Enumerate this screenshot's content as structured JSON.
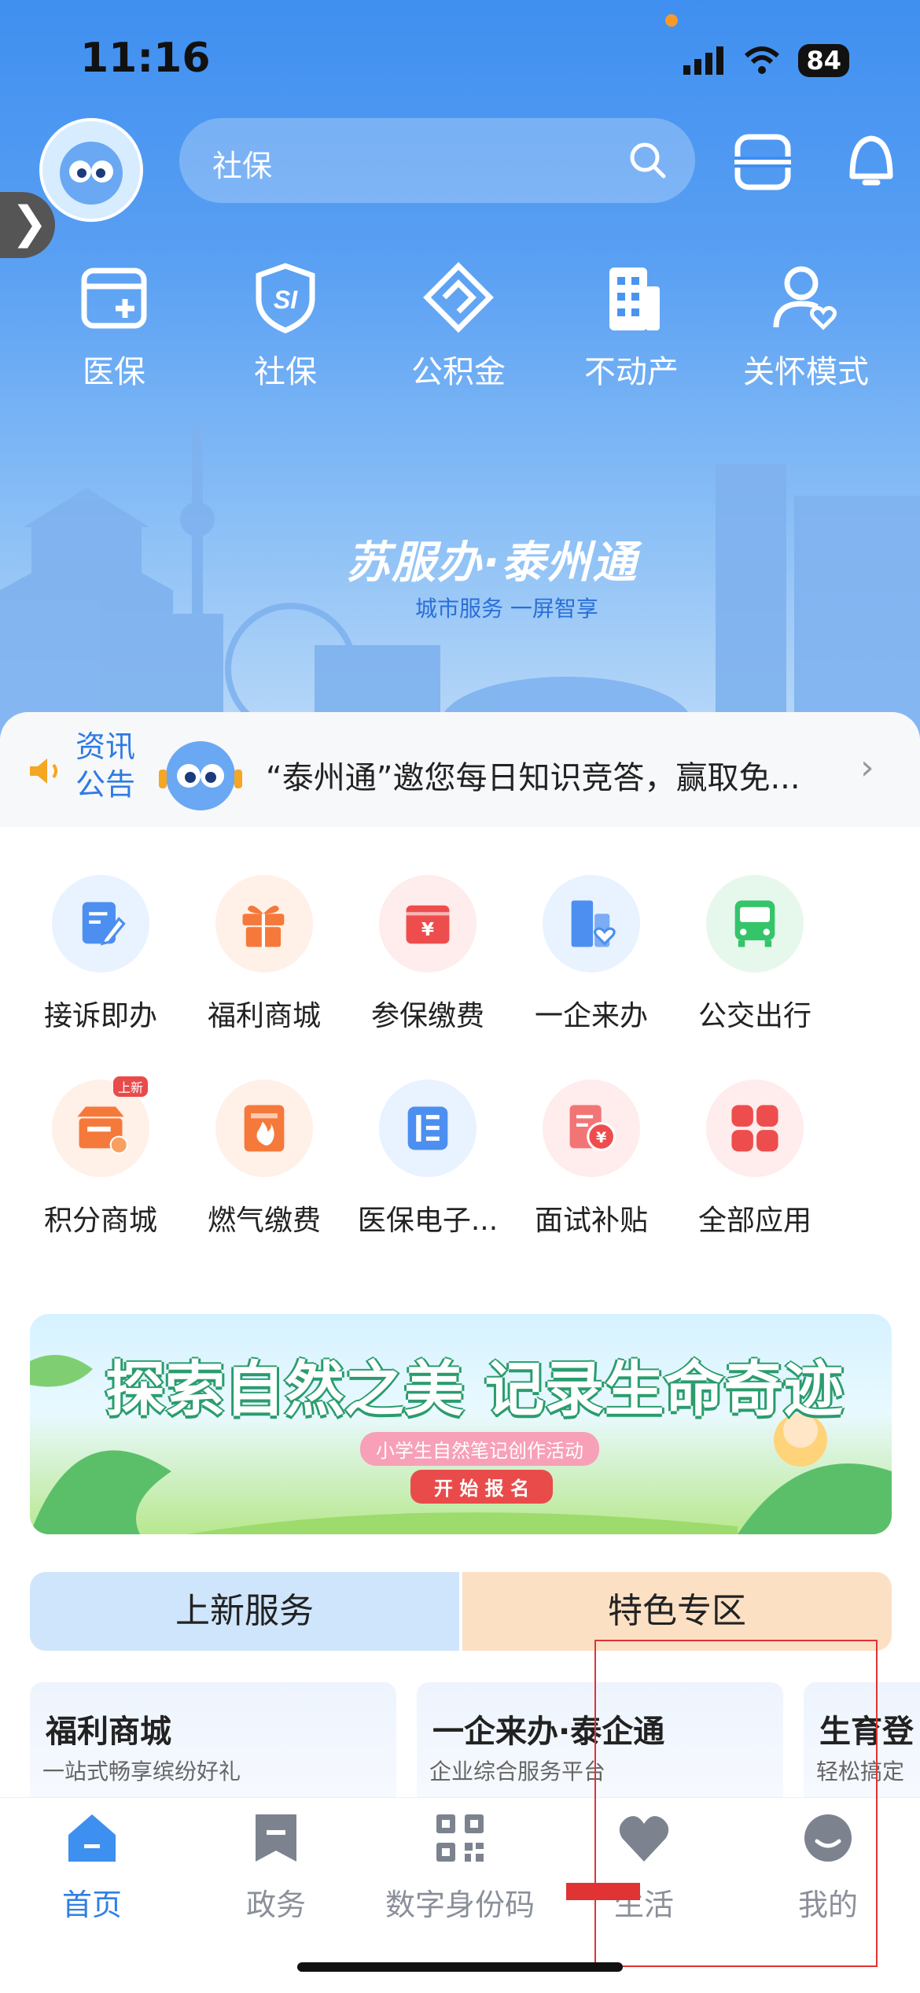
{
  "status": {
    "time": "11:16",
    "battery": "84"
  },
  "header": {
    "search_text": "社保"
  },
  "quick_services": [
    {
      "label": "医保",
      "icon": "medical-card-icon"
    },
    {
      "label": "社保",
      "icon": "social-security-shield-icon"
    },
    {
      "label": "公积金",
      "icon": "housing-fund-icon"
    },
    {
      "label": "不动产",
      "icon": "building-icon"
    },
    {
      "label": "关怀模式",
      "icon": "care-mode-user-icon"
    }
  ],
  "brand": {
    "title": "苏服办·泰州通",
    "subtitle": "城市服务 一屏智享"
  },
  "notice": {
    "label_line1": "资讯",
    "label_line2": "公告",
    "text": "“泰州通”邀您每日知识竞答，赢取免..."
  },
  "apps": [
    {
      "label": "接诉即办",
      "icon": "complaint-edit-icon",
      "color": "#4c8ff0",
      "bg": "#e9f2ff"
    },
    {
      "label": "福利商城",
      "icon": "gift-icon",
      "color": "#f5793a",
      "bg": "#fff0e8"
    },
    {
      "label": "参保缴费",
      "icon": "yuan-wallet-icon",
      "color": "#ee4d4d",
      "bg": "#ffecec"
    },
    {
      "label": "一企来办",
      "icon": "enterprise-building-icon",
      "color": "#4c8ff0",
      "bg": "#e9f2ff"
    },
    {
      "label": "公交出行",
      "icon": "bus-icon",
      "color": "#34c46a",
      "bg": "#e6f8ec"
    },
    {
      "label": "积分商城",
      "icon": "points-store-icon",
      "color": "#f5793a",
      "bg": "#fff0e8",
      "badge": "上新"
    },
    {
      "label": "燃气缴费",
      "icon": "gas-flame-icon",
      "color": "#f5793a",
      "bg": "#fff0e8"
    },
    {
      "label": "医保电子...",
      "icon": "e-medical-card-icon",
      "color": "#4c8ff0",
      "bg": "#e9f2ff"
    },
    {
      "label": "面试补贴",
      "icon": "subsidy-doc-icon",
      "color": "#ee4d4d",
      "bg": "#ffecec"
    },
    {
      "label": "全部应用",
      "icon": "all-apps-grid-icon",
      "color": "#ee4d4d",
      "bg": "#ffecec"
    }
  ],
  "banner": {
    "title": "探索自然之美 记录生命奇迹",
    "subtitle": "小学生自然笔记创作活动",
    "button": "开 始 报 名"
  },
  "section_tabs": {
    "new": "上新服务",
    "feature": "特色专区"
  },
  "cards": [
    {
      "title": "福利商城",
      "subtitle": "一站式畅享缤纷好礼"
    },
    {
      "title": "一企来办·泰企通",
      "subtitle": "企业综合服务平台"
    },
    {
      "title": "生育登",
      "subtitle": "轻松搞定"
    }
  ],
  "tabbar": [
    {
      "label": "首页",
      "icon": "home-icon",
      "active": true
    },
    {
      "label": "政务",
      "icon": "bookmark-icon",
      "active": false
    },
    {
      "label": "数字身份码",
      "icon": "qr-code-icon",
      "active": false
    },
    {
      "label": "生活",
      "icon": "heart-icon",
      "active": false
    },
    {
      "label": "我的",
      "icon": "profile-icon",
      "active": false
    }
  ],
  "colors": {
    "accent": "#2f7fe4",
    "hero": "#4a94f1"
  }
}
